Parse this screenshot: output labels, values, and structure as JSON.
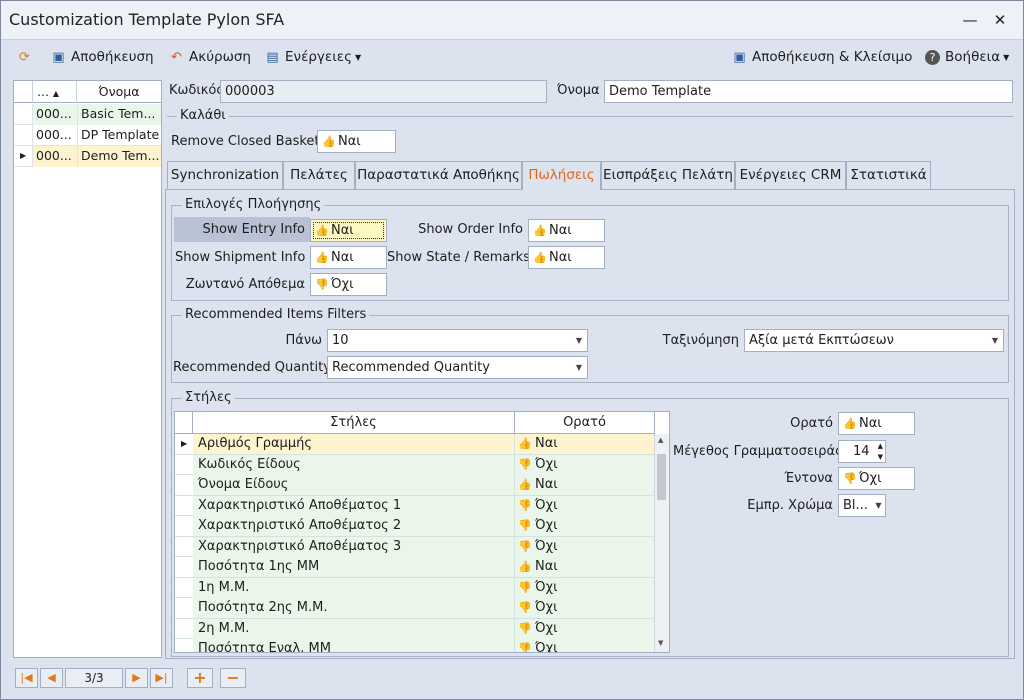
{
  "window": {
    "title": "Customization Template Pylon SFA",
    "minimize": "—",
    "close": "✕"
  },
  "toolbar": {
    "save": "Αποθήκευση",
    "cancel": "Ακύρωση",
    "actions": "Ενέργειες",
    "save_close": "Αποθήκευση & Κλείσιμο",
    "help": "Βοήθεια"
  },
  "left_grid": {
    "col_code": "...",
    "col_name": "Όνομα",
    "rows": [
      {
        "code": "000...",
        "name": "Basic Tem..."
      },
      {
        "code": "000...",
        "name": "DP Template"
      },
      {
        "code": "000...",
        "name": "Demo Tem..."
      }
    ]
  },
  "header": {
    "code_label": "Κωδικός",
    "code_value": "000003",
    "name_label": "Όνομα",
    "name_value": "Demo Template"
  },
  "basket": {
    "title": "Καλάθι",
    "remove_closed_label": "Remove Closed Baskets",
    "remove_closed_value": "Ναι"
  },
  "tabs": [
    "Synchronization",
    "Πελάτες",
    "Παραστατικά Αποθήκης",
    "Πωλήσεις",
    "Εισπράξεις Πελάτη",
    "Ενέργειες CRM",
    "Στατιστικά"
  ],
  "active_tab": "Πωλήσεις",
  "nav_options": {
    "title": "Επιλογές Πλοήγησης",
    "show_entry_label": "Show Entry Info",
    "show_entry_value": "Ναι",
    "show_shipment_label": "Show Shipment Info",
    "show_shipment_value": "Ναι",
    "live_stock_label": "Ζωντανό Απόθεμα",
    "live_stock_value": "Όχι",
    "show_order_label": "Show Order Info",
    "show_order_value": "Ναι",
    "show_state_label": "Show State / Remarks",
    "show_state_value": "Ναι"
  },
  "recommended": {
    "title": "Recommended Items Filters",
    "top_label": "Πάνω",
    "top_value": "10",
    "qty_label": "Recommended Quantity",
    "qty_value": "Recommended Quantity",
    "sort_label": "Ταξινόμηση",
    "sort_value": "Αξία μετά Εκπτώσεων"
  },
  "columns": {
    "title": "Στήλες",
    "header_col": "Στήλες",
    "header_visible": "Ορατό",
    "rows": [
      {
        "name": "Αριθμός Γραμμής",
        "visible": "Ναι",
        "up": true
      },
      {
        "name": "Κωδικός Είδους",
        "visible": "Όχι",
        "up": false
      },
      {
        "name": "Όνομα Είδους",
        "visible": "Ναι",
        "up": true
      },
      {
        "name": "Χαρακτηριστικό Αποθέματος 1",
        "visible": "Όχι",
        "up": false
      },
      {
        "name": "Χαρακτηριστικό Αποθέματος 2",
        "visible": "Όχι",
        "up": false
      },
      {
        "name": "Χαρακτηριστικό Αποθέματος 3",
        "visible": "Όχι",
        "up": false
      },
      {
        "name": "Ποσότητα 1ης ΜΜ",
        "visible": "Ναι",
        "up": true
      },
      {
        "name": "1η Μ.Μ.",
        "visible": "Όχι",
        "up": false
      },
      {
        "name": "Ποσότητα 2ης Μ.Μ.",
        "visible": "Όχι",
        "up": false
      },
      {
        "name": "2η Μ.Μ.",
        "visible": "Όχι",
        "up": false
      },
      {
        "name": "Ποσότητα Εναλ. ΜΜ",
        "visible": "Όχι",
        "up": false
      }
    ]
  },
  "props": {
    "visible_label": "Ορατό",
    "visible_value": "Ναι",
    "font_size_label": "Μέγεθος Γραμματοσειράς",
    "font_size_value": "14",
    "bold_label": "Έντονα",
    "bold_value": "Όχι",
    "fg_label": "Εμπρ. Χρώμα",
    "fg_value": "Bl..."
  },
  "nav": {
    "page": "3/3"
  },
  "colors": {
    "accent": "#e0661a",
    "thumb_up": "#3a9a58",
    "thumb_down": "#d05424",
    "selected_row": "#fdf3cf",
    "green_row": "#eaf6ea"
  }
}
